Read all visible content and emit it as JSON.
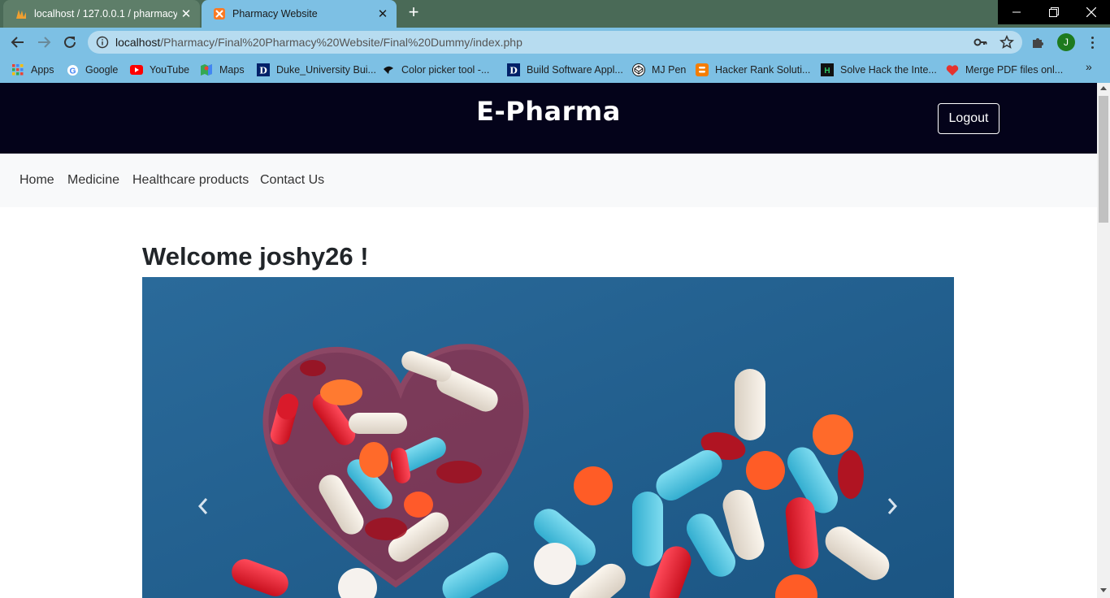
{
  "browser": {
    "tabs": [
      {
        "title": "localhost / 127.0.0.1 / pharmacy",
        "active": false
      },
      {
        "title": "Pharmacy Website",
        "active": true
      }
    ],
    "address": {
      "host": "localhost",
      "path": "/Pharmacy/Final%20Pharmacy%20Website/Final%20Dummy/index.php"
    },
    "profile_initial": "J",
    "bookmarks": [
      {
        "label": "Apps",
        "icon": "apps-grid-icon"
      },
      {
        "label": "Google",
        "icon": "google-icon"
      },
      {
        "label": "YouTube",
        "icon": "youtube-icon"
      },
      {
        "label": "Maps",
        "icon": "maps-icon"
      },
      {
        "label": "Duke_University Bui...",
        "icon": "duke-icon"
      },
      {
        "label": "Color picker tool -...",
        "icon": "color-picker-icon"
      },
      {
        "label": "Build Software Appl...",
        "icon": "duke-icon"
      },
      {
        "label": "MJ Pen",
        "icon": "codepen-icon"
      },
      {
        "label": "Hacker Rank Soluti...",
        "icon": "blogger-icon"
      },
      {
        "label": "Solve Hack the Inte...",
        "icon": "hackerrank-icon"
      },
      {
        "label": "Merge PDF files onl...",
        "icon": "heart-pdf-icon"
      }
    ],
    "more_bookmarks": "»"
  },
  "site": {
    "brand": "E-Pharma",
    "logout_label": "Logout",
    "nav": [
      "Home",
      "Medicine",
      "Healthcare products",
      "Contact Us"
    ],
    "welcome": "Welcome joshy26 !"
  },
  "colors": {
    "header_bg": "#04031a",
    "nav_bg": "#f8f9fa",
    "tab_active": "#7dc0e4",
    "tabstrip": "#4a6a57",
    "carousel_bg": "#1f5d8d"
  }
}
